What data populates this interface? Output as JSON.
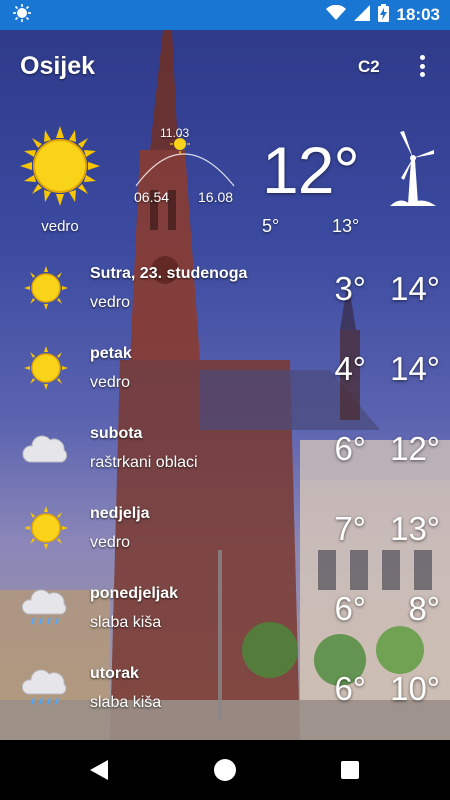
{
  "status_bar": {
    "time": "18:03",
    "icons": [
      "weather-app-icon",
      "wifi-icon",
      "signal-icon",
      "battery-charging-icon"
    ]
  },
  "app_bar": {
    "city": "Osijek",
    "unit": "C2",
    "menu_icon": "more-vert-icon"
  },
  "current": {
    "icon": "sun-icon",
    "condition": "vedro",
    "sun": {
      "noon": "11.03",
      "sunrise": "06.54",
      "sunset": "16.08"
    },
    "temp": "12°",
    "min": "5°",
    "max": "13°",
    "wind_icon": "wind-turbine-icon"
  },
  "forecast": [
    {
      "name": "Sutra, 23. studenoga",
      "condition": "vedro",
      "min": "3°",
      "max": "14°",
      "icon": "sun-icon"
    },
    {
      "name": "petak",
      "condition": "vedro",
      "min": "4°",
      "max": "14°",
      "icon": "sun-icon"
    },
    {
      "name": "subota",
      "condition": "raštrkani oblaci",
      "min": "6°",
      "max": "12°",
      "icon": "cloud-icon"
    },
    {
      "name": "nedjelja",
      "condition": "vedro",
      "min": "7°",
      "max": "13°",
      "icon": "sun-icon"
    },
    {
      "name": "ponedjeljak",
      "condition": "slaba kiša",
      "min": "6°",
      "max": "8°",
      "icon": "rain-cloud-icon"
    },
    {
      "name": "utorak",
      "condition": "slaba kiša",
      "min": "6°",
      "max": "10°",
      "icon": "rain-cloud-icon"
    }
  ],
  "nav_bar": {
    "icons": [
      "back-icon",
      "home-icon",
      "recents-icon"
    ]
  }
}
